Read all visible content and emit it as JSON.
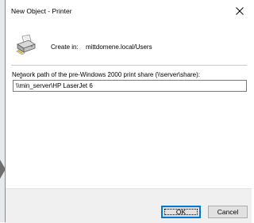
{
  "window": {
    "title": "New Object - Printer",
    "close_glyph": "×"
  },
  "location": {
    "label": "Create in:",
    "value": "mittdomene.local/Users"
  },
  "share_path": {
    "label_prefix": "Ne",
    "label_mnemonic": "t",
    "label_suffix": "work path of the pre-Windows 2000 print share (\\\\server\\share):",
    "value": "\\\\min_server\\HP LaserJet 6"
  },
  "buttons": {
    "ok_label": "OK",
    "cancel_label": "Cancel"
  },
  "icons": {
    "window_close": "close-icon",
    "object_type": "printer-icon",
    "side_pointer": "arrow-right-icon"
  },
  "colors": {
    "accent": "#0078d7",
    "footer_bg": "#f0f0f0",
    "button_bg": "#e1e1e1"
  }
}
